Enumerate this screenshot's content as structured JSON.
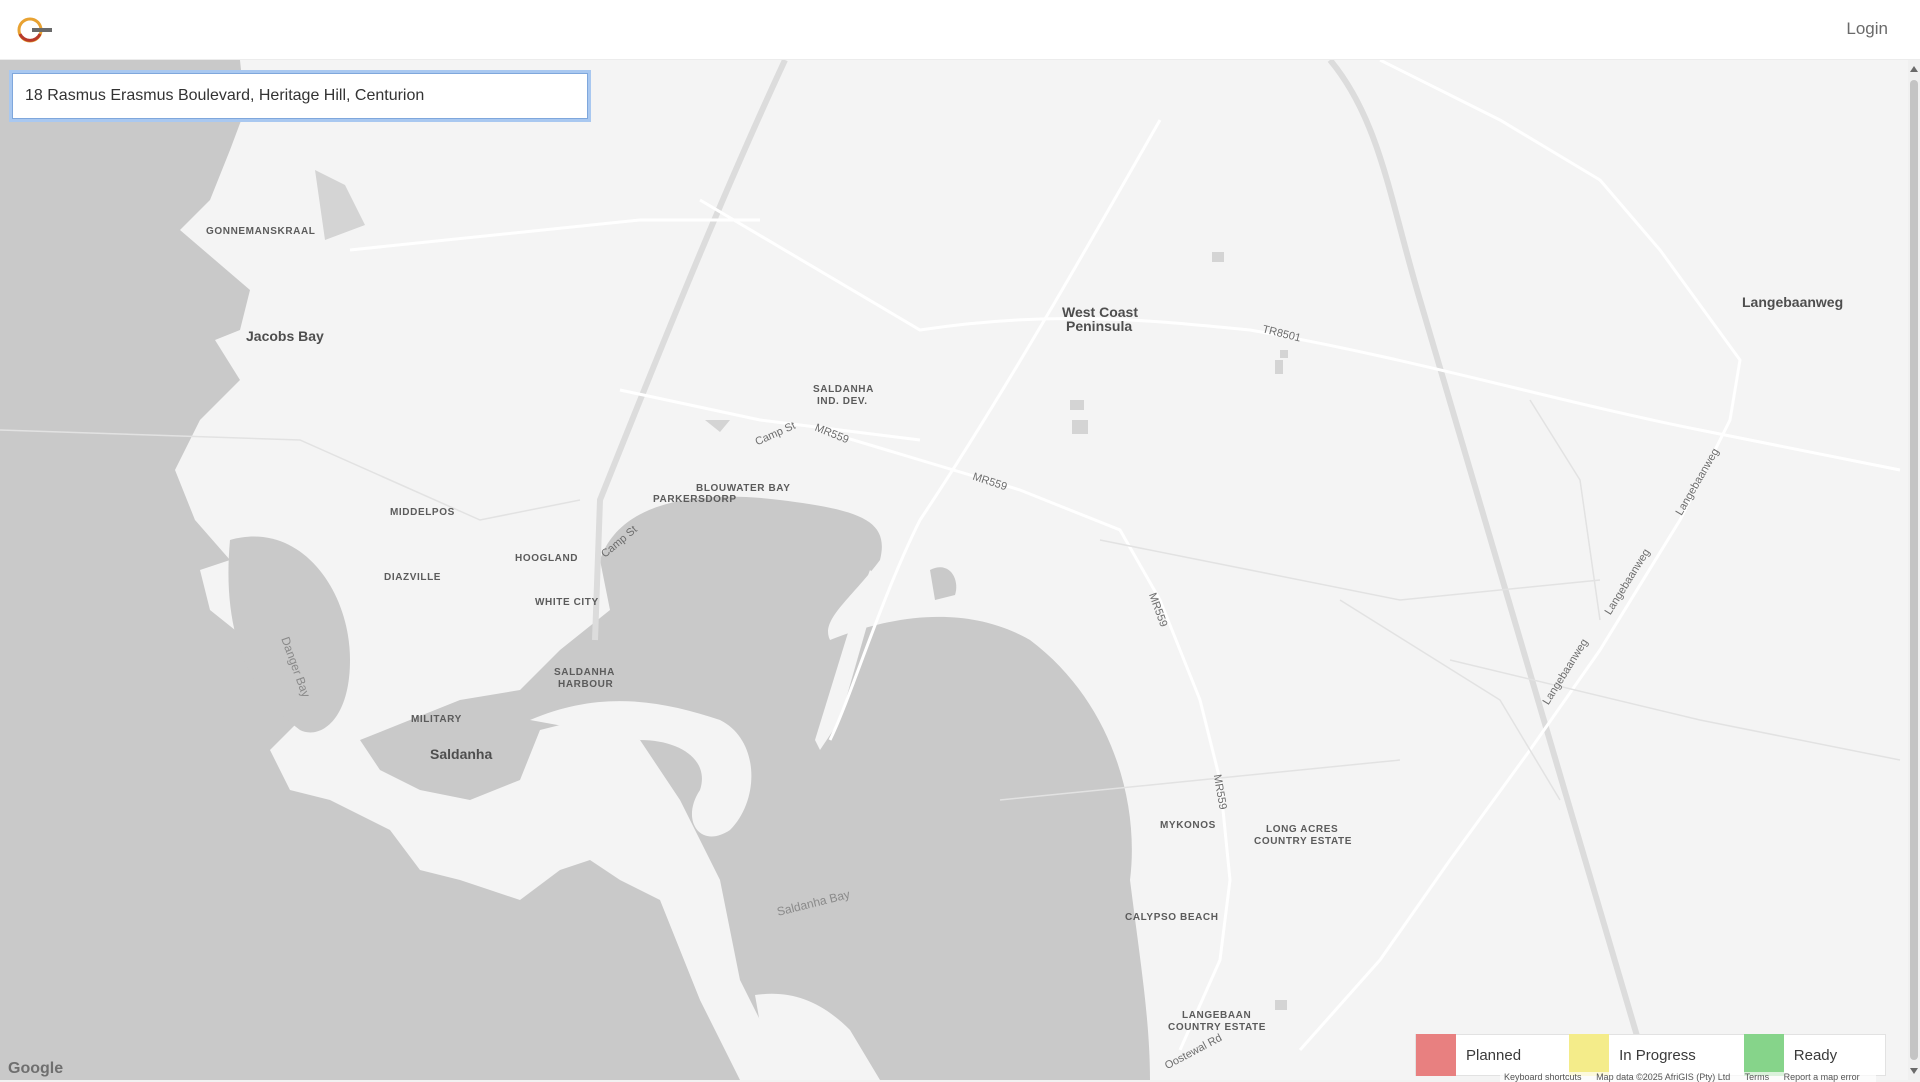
{
  "header": {
    "logo_icon": "company-logo-icon",
    "login_label": "Login"
  },
  "search": {
    "value": "18 Rasmus Erasmus Boulevard, Heritage Hill, Centurion"
  },
  "map": {
    "places": {
      "gonnemanskraal": "GONNEMANSKRAAL",
      "jacobs_bay": "Jacobs Bay",
      "west_coast_peninsula_1": "West Coast",
      "west_coast_peninsula_2": "Peninsula",
      "langebaanweg": "Langebaanweg",
      "saldanha_ind_1": "SALDANHA",
      "saldanha_ind_2": "IND. DEV.",
      "blouwater_bay": "BLOUWATER BAY",
      "parkersdorp": "PARKERSDORP",
      "middelpos": "MIDDELPOS",
      "hoogland": "HOOGLAND",
      "diazville": "DIAZVILLE",
      "white_city": "WHITE CITY",
      "saldanha_harbour_1": "SALDANHA",
      "saldanha_harbour_2": "HARBOUR",
      "military": "MILITARY",
      "saldanha": "Saldanha",
      "mykonos": "MYKONOS",
      "long_acres_1": "LONG ACRES",
      "long_acres_2": "COUNTRY ESTATE",
      "calypso_beach": "CALYPSO BEACH",
      "langebaan_ce_1": "LANGEBAAN",
      "langebaan_ce_2": "COUNTRY ESTATE"
    },
    "roads": {
      "tr8501": "TR8501",
      "camp_st_1": "Camp St",
      "camp_st_2": "Camp St",
      "mr559_1": "MR559",
      "mr559_2": "MR559",
      "mr559_3": "MR559",
      "mr559_4": "MR559",
      "langebaanweg_1": "Langebaanweg",
      "langebaanweg_2": "Langebaanweg",
      "langebaanweg_3": "Langebaanweg",
      "oostewal_rd": "Oostewal Rd"
    },
    "water": {
      "danger_bay": "Danger Bay",
      "saldanha_bay": "Saldanha Bay"
    },
    "google_logo": "Google",
    "attribution": {
      "keyboard": "Keyboard shortcuts",
      "map_data": "Map data ©2025 AfriGIS (Pty) Ltd",
      "terms": "Terms",
      "report": "Report a map error"
    }
  },
  "legend": {
    "items": [
      {
        "label": "Planned",
        "color": "#e88080"
      },
      {
        "label": "In Progress",
        "color": "#f4ec8a"
      },
      {
        "label": "Ready",
        "color": "#86d48a"
      }
    ]
  }
}
